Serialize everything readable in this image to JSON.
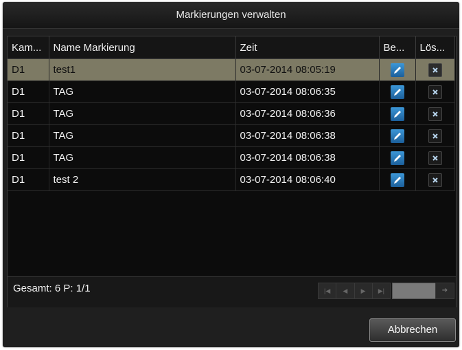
{
  "dialog": {
    "title": "Markierungen verwalten",
    "columns": [
      "Kam...",
      "Name Markierung",
      "Zeit",
      "Be...",
      "Lös..."
    ],
    "rows": [
      {
        "cam": "D1",
        "name": "test1",
        "time": "03-07-2014 08:05:19",
        "selected": true
      },
      {
        "cam": "D1",
        "name": "TAG",
        "time": "03-07-2014 08:06:35",
        "selected": false
      },
      {
        "cam": "D1",
        "name": "TAG",
        "time": "03-07-2014 08:06:36",
        "selected": false
      },
      {
        "cam": "D1",
        "name": "TAG",
        "time": "03-07-2014 08:06:38",
        "selected": false
      },
      {
        "cam": "D1",
        "name": "TAG",
        "time": "03-07-2014 08:06:38",
        "selected": false
      },
      {
        "cam": "D1",
        "name": "test 2",
        "time": "03-07-2014 08:06:40",
        "selected": false
      }
    ],
    "summary": "Gesamt: 6 P: 1/1",
    "cancel_label": "Abbrechen",
    "colors": {
      "selected_row": "#7d7a64",
      "edit_icon": "#2f86c8"
    }
  }
}
